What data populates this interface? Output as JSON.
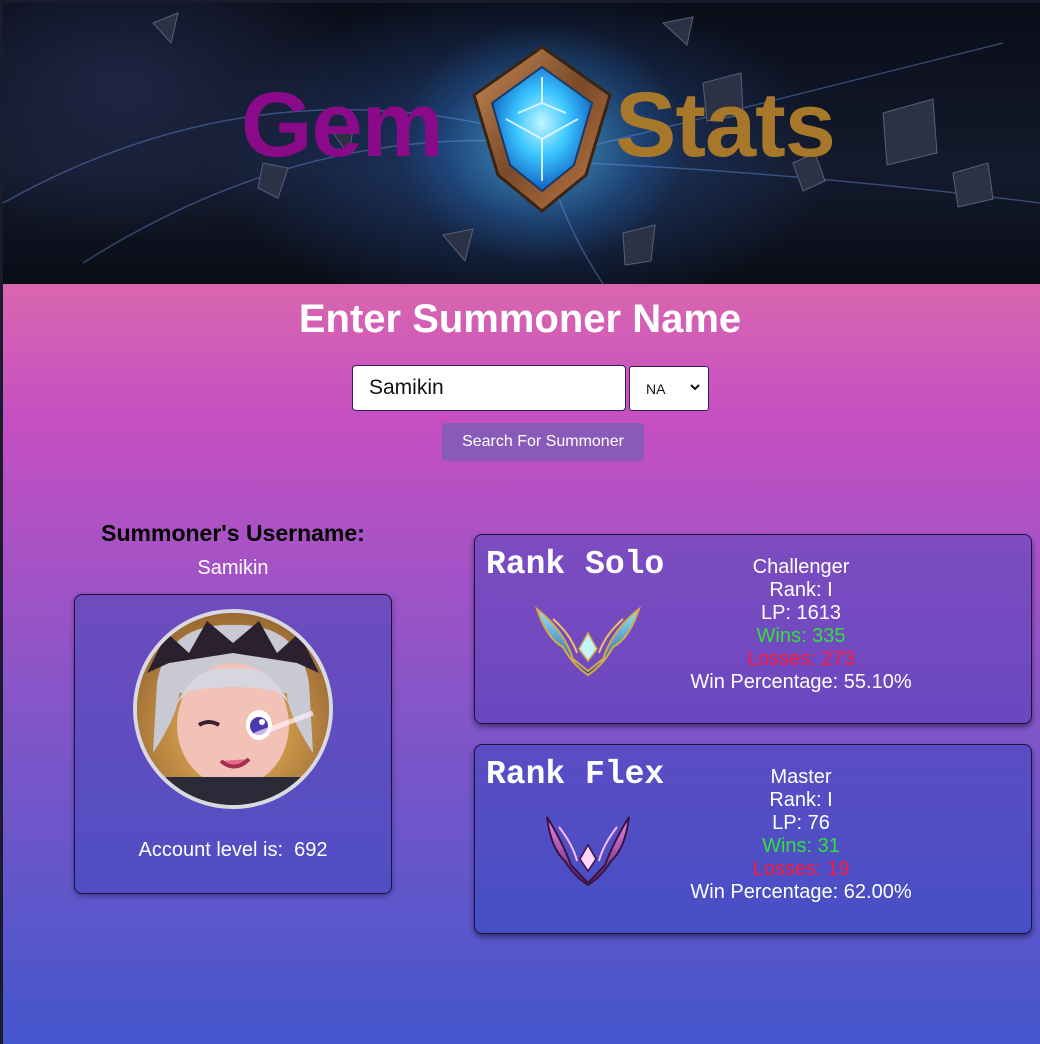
{
  "banner": {
    "logo_left": "Gem",
    "logo_right": "Stats",
    "colors": {
      "gem_word": "#8a0a8a",
      "stats_word": "#a8782a",
      "crystal": "#3ad0ff"
    }
  },
  "search": {
    "title": "Enter Summoner Name",
    "input_value": "Samikin",
    "region_selected": "NA",
    "button_label": "Search For Summoner"
  },
  "summoner": {
    "heading": "Summoner's Username:",
    "name": "Samikin",
    "avatar_icon": "champion-portrait",
    "account_level_text": "Account level is:  692"
  },
  "ranks": {
    "solo": {
      "title": "Rank Solo",
      "emblem_icon": "challenger-emblem",
      "tier": "Challenger",
      "rank": "Rank: I",
      "lp": "LP: 1613",
      "wins": "Wins: 335",
      "losses": "Losses: 273",
      "win_percentage": "Win Percentage: 55.10%"
    },
    "flex": {
      "title": "Rank Flex",
      "emblem_icon": "master-emblem",
      "tier": "Master",
      "rank": "Rank: I",
      "lp": "LP: 76",
      "wins": "Wins: 31",
      "losses": "Losses: 19",
      "win_percentage": "Win Percentage: 62.00%"
    }
  },
  "colors": {
    "wins": "#2fe23a",
    "losses": "#ff1a3a",
    "button": "#8a5ab8"
  }
}
